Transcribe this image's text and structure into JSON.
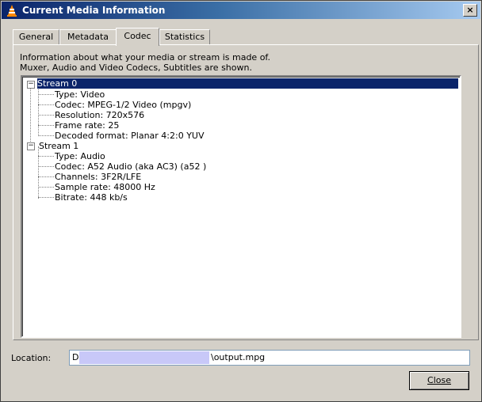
{
  "window": {
    "title": "Current Media Information",
    "close_glyph": "×"
  },
  "tabs": [
    {
      "label": "General"
    },
    {
      "label": "Metadata"
    },
    {
      "label": "Codec"
    },
    {
      "label": "Statistics"
    }
  ],
  "active_tab": "Codec",
  "codec_panel": {
    "description_line1": "Information about what your media or stream is made of.",
    "description_line2": "Muxer, Audio and Video Codecs, Subtitles are shown.",
    "streams": [
      {
        "label": "Stream 0",
        "details": [
          "Type: Video",
          "Codec: MPEG-1/2 Video (mpgv)",
          "Resolution: 720x576",
          "Frame rate: 25",
          "Decoded format: Planar 4:2:0 YUV"
        ]
      },
      {
        "label": "Stream 1",
        "details": [
          "Type: Audio",
          "Codec: A52 Audio (aka AC3) (a52 )",
          "Channels: 3F2R/LFE",
          "Sample rate: 48000 Hz",
          "Bitrate: 448 kb/s"
        ]
      }
    ]
  },
  "location": {
    "label": "Location:",
    "prefix": "D",
    "suffix": "\\output.mpg"
  },
  "buttons": {
    "close": "Close"
  },
  "colors": {
    "selection": "#0a246a",
    "redaction": "#c8c8f8"
  },
  "icons": {
    "app": "vlc-cone-icon",
    "close": "close-icon",
    "expander": "minus-icon"
  }
}
